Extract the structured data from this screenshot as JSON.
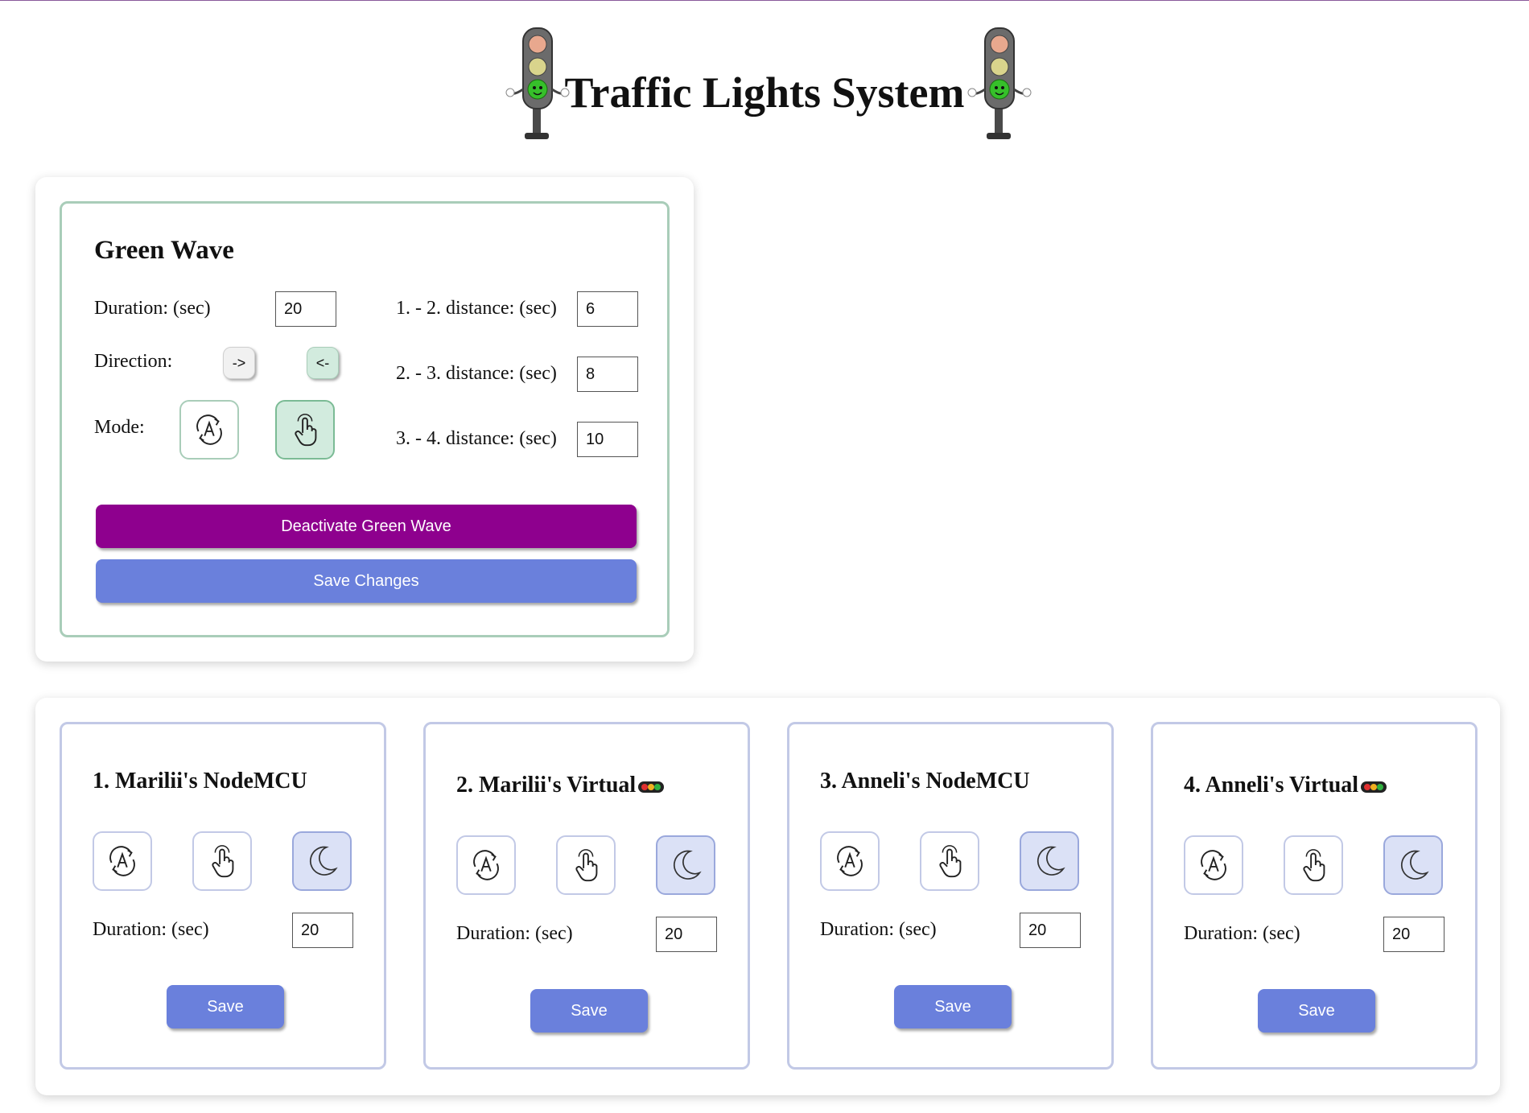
{
  "page": {
    "title": "Traffic Lights System"
  },
  "icons": {
    "header_left": "traffic-light-character-icon",
    "header_right": "traffic-light-character-icon",
    "auto_mode": "auto-cycle-icon",
    "manual_mode": "hand-pointer-icon",
    "night_mode": "moon-icon",
    "virtual_badge": "traffic-light-emoji-icon"
  },
  "colors": {
    "deactivate": "#8e008e",
    "save": "#6a80dc",
    "green_border": "#a9cdb9",
    "node_border": "#c2c9e6",
    "active_green": "#d2ebde",
    "active_blue": "#dbe1f6"
  },
  "green_wave": {
    "title": "Green Wave",
    "duration_label": "Duration: (sec)",
    "duration_value": "20",
    "direction_label": "Direction:",
    "direction_forward": "->",
    "direction_backward": "<-",
    "mode_label": "Mode:",
    "distance_1_2_label": "1. - 2. distance: (sec)",
    "distance_1_2_value": "6",
    "distance_2_3_label": "2. - 3. distance: (sec)",
    "distance_2_3_value": "8",
    "distance_3_4_label": "3. - 4. distance: (sec)",
    "distance_3_4_value": "10",
    "deactivate_label": "Deactivate Green Wave",
    "save_label": "Save Changes"
  },
  "nodes": [
    {
      "title": "1. Marilii's NodeMCU",
      "duration_label": "Duration: (sec)",
      "duration_value": "20",
      "save_label": "Save"
    },
    {
      "title": "2. Marilii's Virtual",
      "duration_label": "Duration: (sec)",
      "duration_value": "20",
      "save_label": "Save"
    },
    {
      "title": "3. Anneli's NodeMCU",
      "duration_label": "Duration: (sec)",
      "duration_value": "20",
      "save_label": "Save"
    },
    {
      "title": "4. Anneli's Virtual",
      "duration_label": "Duration: (sec)",
      "duration_value": "20",
      "save_label": "Save"
    }
  ]
}
